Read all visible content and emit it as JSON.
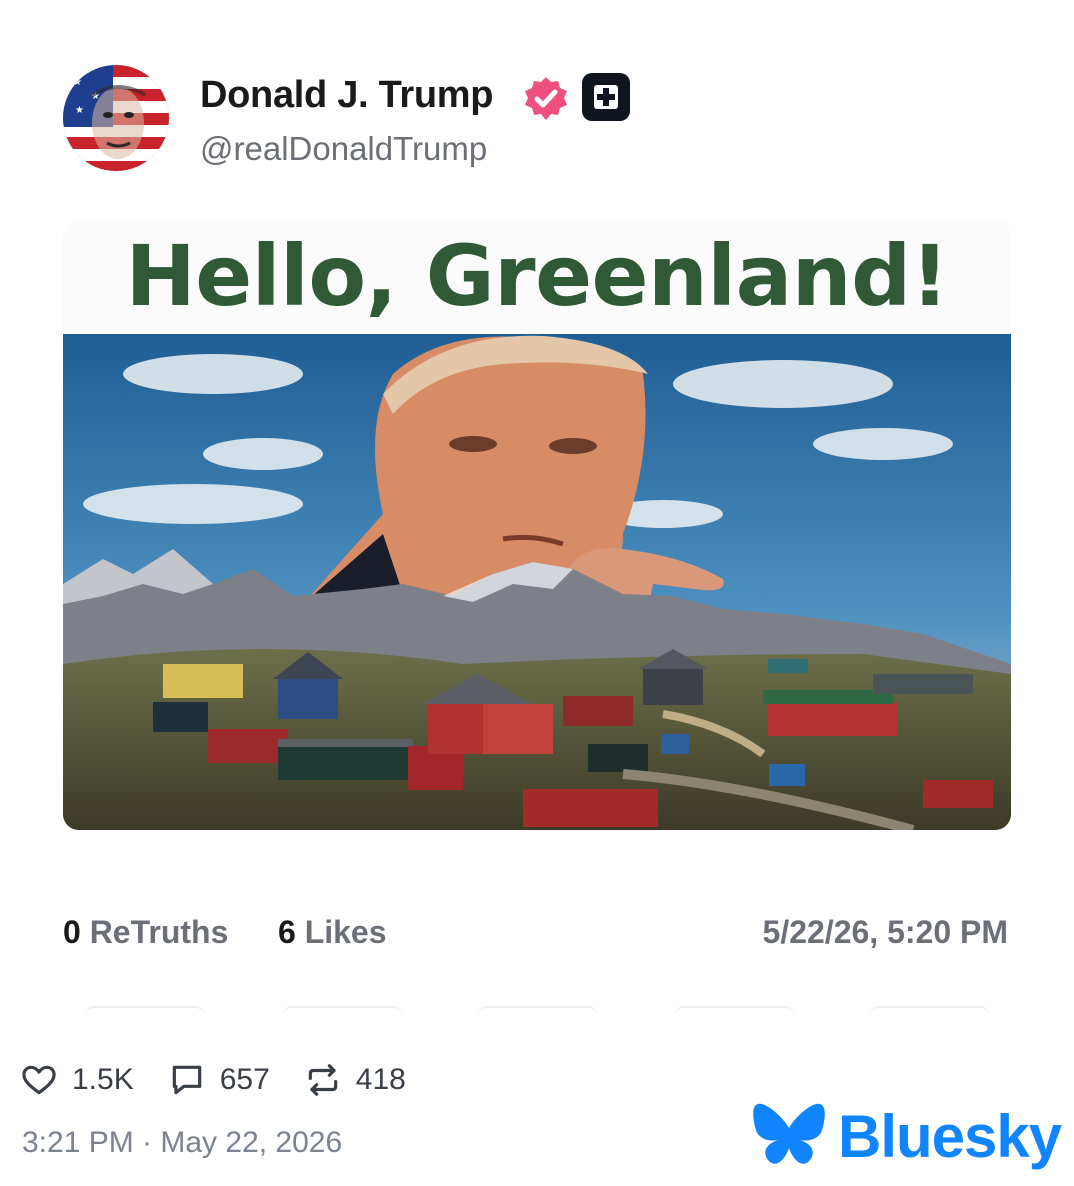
{
  "post": {
    "author": {
      "display_name": "Donald J. Trump",
      "handle": "@realDonaldTrump",
      "verified_icon": "verified-check-icon",
      "plus_icon": "plus-icon"
    },
    "media": {
      "headline": "Hello, Greenland!"
    },
    "stats": {
      "retruths_count": "0",
      "retruths_label": "ReTruths",
      "likes_count": "6",
      "likes_label": "Likes",
      "timestamp": "5/22/26, 5:20 PM"
    }
  },
  "bluesky": {
    "likes": "1.5K",
    "replies": "657",
    "reposts": "418",
    "date": "3:21 PM · May 22, 2026",
    "brand": "Bluesky",
    "brand_color": "#1185fe"
  },
  "colors": {
    "headline_green": "#2f5a35",
    "verified_pink": "#f0507d"
  }
}
